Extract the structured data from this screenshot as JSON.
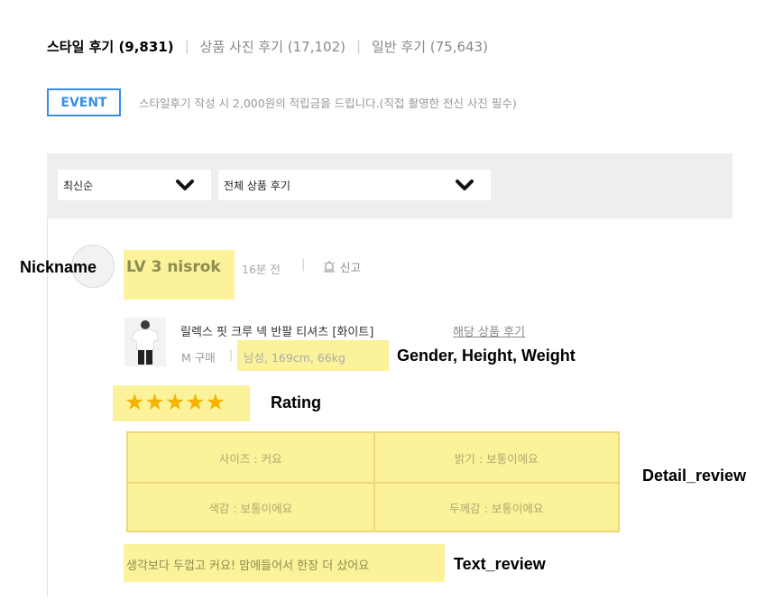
{
  "tabs": {
    "style": "스타일 후기 (9,831)",
    "photo": "상품 사진 후기 (17,102)",
    "general": "일반 후기 (75,643)",
    "separator": "|"
  },
  "event": {
    "badge": "EVENT",
    "text": "스타일후기 작성 시 2,000원의 적립금을 드립니다.(직접 촬영한 전신 사진 필수)"
  },
  "filters": {
    "sort": "최신순",
    "type": "전체 상품 후기"
  },
  "review": {
    "nickname": "LV 3 nisrok",
    "time": "16분 전",
    "separator": "|",
    "report_label": "신고",
    "product_name": "릴렉스 핏 크루 넥 반팔 티셔츠 [화이트]",
    "product_link": "해당 상품 후기",
    "purchase": "M 구매",
    "purchase_sep": "|",
    "body_info": "남성, 169cm, 66kg",
    "rating": 5,
    "rating_stars": "★★★★★",
    "details": {
      "size": "사이즈 : 커요",
      "brightness": "밝기 : 보통이에요",
      "color": "색감 : 보통이에요",
      "thickness": "두께감 : 보통이에요"
    },
    "text": "생각보다 두껍고 커요! 맘에들어서 한장 더 샀어요"
  },
  "annotations": {
    "nickname": "Nickname",
    "body": "Gender, Height, Weight",
    "rating": "Rating",
    "detail": "Detail_review",
    "text": "Text_review"
  },
  "colors": {
    "highlight": "#fbf29a",
    "event_blue": "#3a8ee6",
    "star": "#f4b400"
  },
  "icons": {
    "sort_dropdown": "chevron-down-icon",
    "type_dropdown": "chevron-down-icon",
    "report": "bell-icon"
  }
}
